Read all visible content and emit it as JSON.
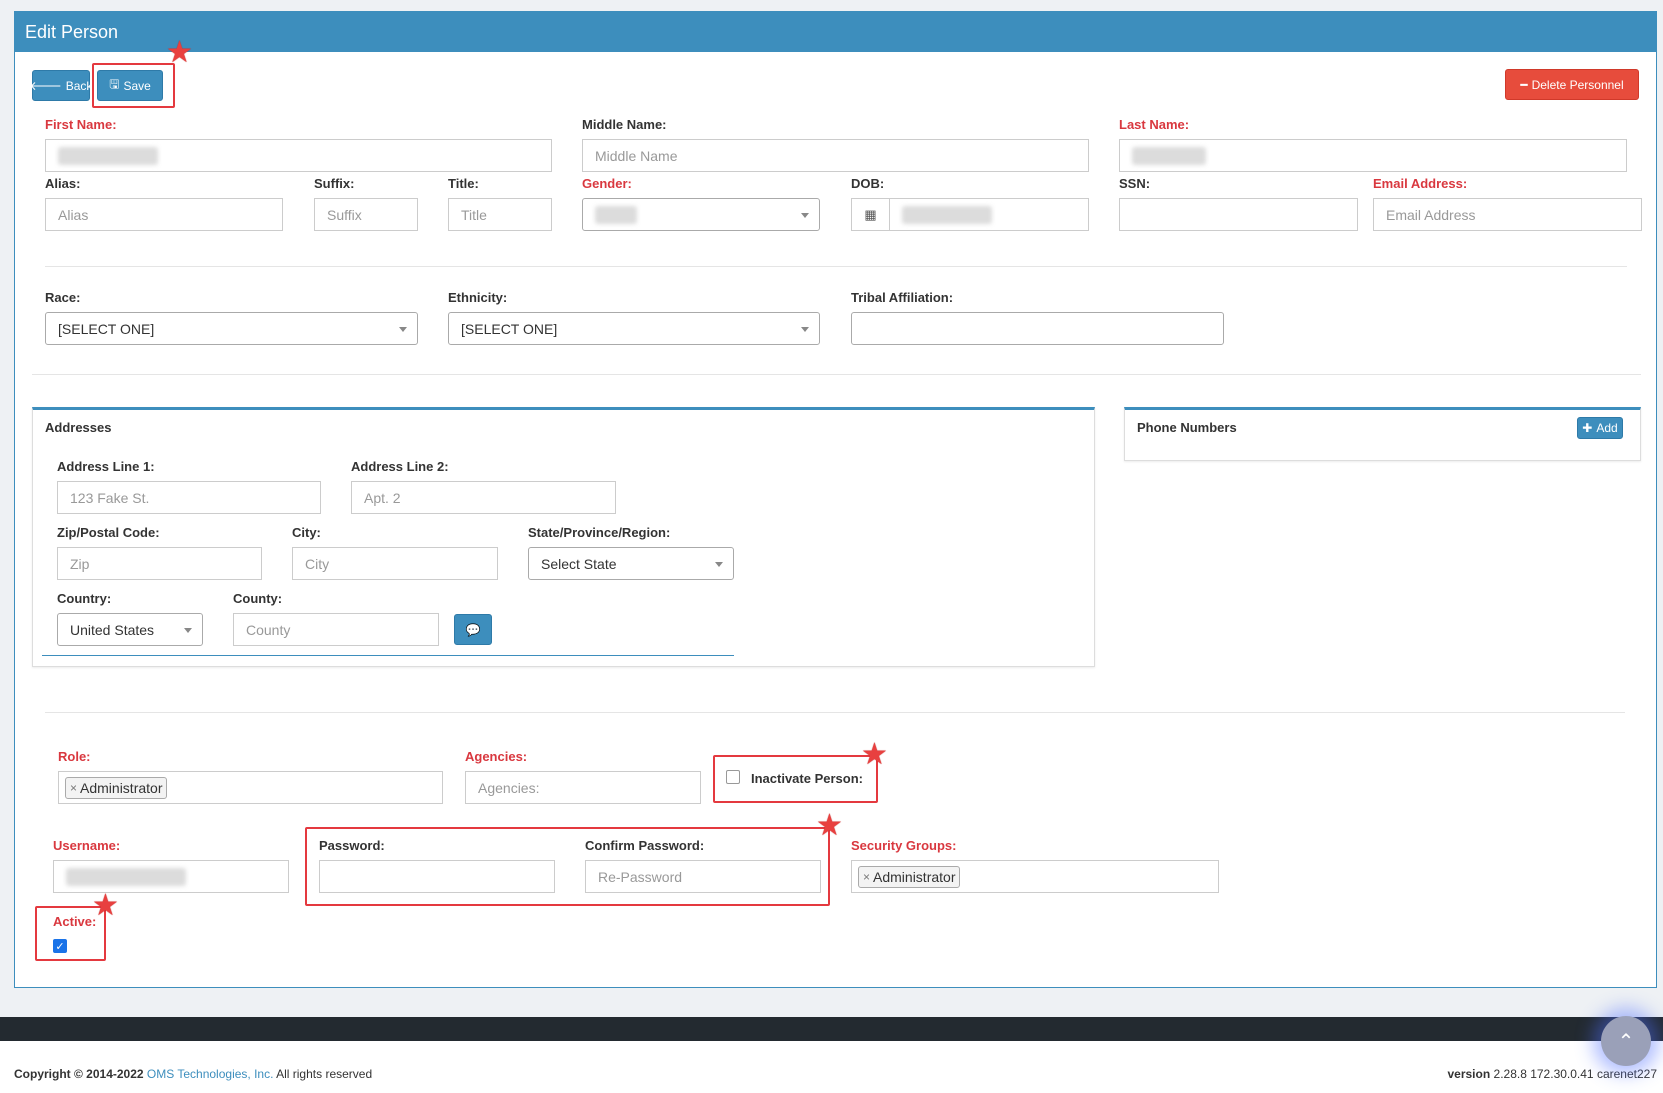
{
  "panel": {
    "title": "Edit Person"
  },
  "toolbar": {
    "back_label": "Back",
    "save_label": "Save",
    "delete_label": "Delete Personnel"
  },
  "person": {
    "first_name_label": "First Name:",
    "middle_name_label": "Middle Name:",
    "middle_name_placeholder": "Middle Name",
    "last_name_label": "Last Name:",
    "alias_label": "Alias:",
    "alias_placeholder": "Alias",
    "suffix_label": "Suffix:",
    "suffix_placeholder": "Suffix",
    "title_label": "Title:",
    "title_placeholder": "Title",
    "gender_label": "Gender:",
    "dob_label": "DOB:",
    "ssn_label": "SSN:",
    "email_label": "Email Address:",
    "email_placeholder": "Email Address",
    "race_label": "Race:",
    "race_value": "[SELECT ONE]",
    "ethnicity_label": "Ethnicity:",
    "ethnicity_value": "[SELECT ONE]",
    "tribal_label": "Tribal Affiliation:"
  },
  "addresses": {
    "title": "Addresses",
    "line1_label": "Address Line 1:",
    "line1_placeholder": "123 Fake St.",
    "line2_label": "Address Line 2:",
    "line2_placeholder": "Apt. 2",
    "zip_label": "Zip/Postal Code:",
    "zip_placeholder": "Zip",
    "city_label": "City:",
    "city_placeholder": "City",
    "state_label": "State/Province/Region:",
    "state_value": "Select State",
    "country_label": "Country:",
    "country_value": "United States",
    "county_label": "County:",
    "county_placeholder": "County"
  },
  "phones": {
    "title": "Phone Numbers",
    "add_label": "Add"
  },
  "account": {
    "role_label": "Role:",
    "role_tag": "Administrator",
    "agencies_label": "Agencies:",
    "agencies_placeholder": "Agencies:",
    "inactivate_label": "Inactivate Person:",
    "username_label": "Username:",
    "password_label": "Password:",
    "confirm_password_label": "Confirm Password:",
    "confirm_password_placeholder": "Re-Password",
    "security_groups_label": "Security Groups:",
    "security_groups_tag": "Administrator",
    "active_label": "Active:"
  },
  "footer": {
    "copyright_prefix": "Copyright © 2014-2022",
    "company": "OMS Technologies, Inc.",
    "rights": "All rights reserved",
    "version_label": "version",
    "version_value": "2.28.8 172.30.0.41 carenet227"
  },
  "colors": {
    "primary": "#3d8ebd",
    "danger": "#e74c3c",
    "required": "#d9383f",
    "highlight": "#e4393f"
  }
}
